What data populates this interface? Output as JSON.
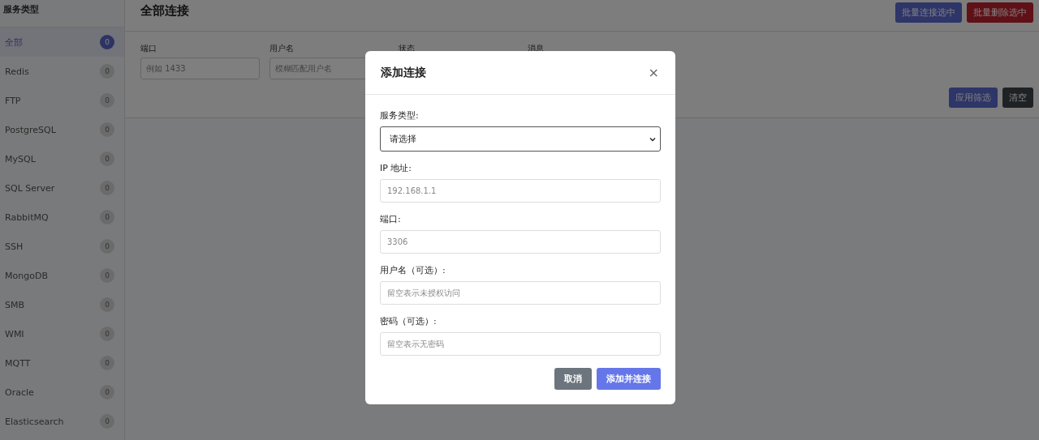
{
  "sidebar": {
    "title": "服务类型",
    "items": [
      {
        "label": "全部",
        "count": "0",
        "selected": true
      },
      {
        "label": "Redis",
        "count": "0",
        "selected": false
      },
      {
        "label": "FTP",
        "count": "0",
        "selected": false
      },
      {
        "label": "PostgreSQL",
        "count": "0",
        "selected": false
      },
      {
        "label": "MySQL",
        "count": "0",
        "selected": false
      },
      {
        "label": "SQL Server",
        "count": "0",
        "selected": false
      },
      {
        "label": "RabbitMQ",
        "count": "0",
        "selected": false
      },
      {
        "label": "SSH",
        "count": "0",
        "selected": false
      },
      {
        "label": "MongoDB",
        "count": "0",
        "selected": false
      },
      {
        "label": "SMB",
        "count": "0",
        "selected": false
      },
      {
        "label": "WMI",
        "count": "0",
        "selected": false
      },
      {
        "label": "MQTT",
        "count": "0",
        "selected": false
      },
      {
        "label": "Oracle",
        "count": "0",
        "selected": false
      },
      {
        "label": "Elasticsearch",
        "count": "0",
        "selected": false
      }
    ]
  },
  "header": {
    "title": "全部连接",
    "actions": [
      {
        "label": "批量连接选中",
        "kind": "primary"
      },
      {
        "label": "批量删除选中",
        "kind": "danger"
      }
    ]
  },
  "filters": [
    {
      "label": "端口",
      "placeholder": "例如 1433"
    },
    {
      "label": "用户名",
      "placeholder": "模糊匹配用户名"
    },
    {
      "label": "状态"
    },
    {
      "label": "消息"
    }
  ],
  "filter_actions": [
    {
      "label": "应用筛选",
      "kind": "primary"
    },
    {
      "label": "清空",
      "kind": "dark"
    }
  ],
  "modal": {
    "title": "添加连接",
    "close": "×",
    "fields": [
      {
        "label": "服务类型:",
        "kind": "select",
        "value": "请选择"
      },
      {
        "label": "IP 地址:",
        "kind": "input",
        "placeholder": "192.168.1.1"
      },
      {
        "label": "端口:",
        "kind": "input",
        "placeholder": "3306"
      },
      {
        "label": "用户名（可选）:",
        "kind": "input",
        "placeholder": "留空表示未授权访问"
      },
      {
        "label": "密码（可选）:",
        "kind": "input",
        "placeholder": "留空表示无密码"
      }
    ],
    "buttons": [
      {
        "label": "取消",
        "kind": "secondary"
      },
      {
        "label": "添加并连接",
        "kind": "primary"
      }
    ]
  }
}
